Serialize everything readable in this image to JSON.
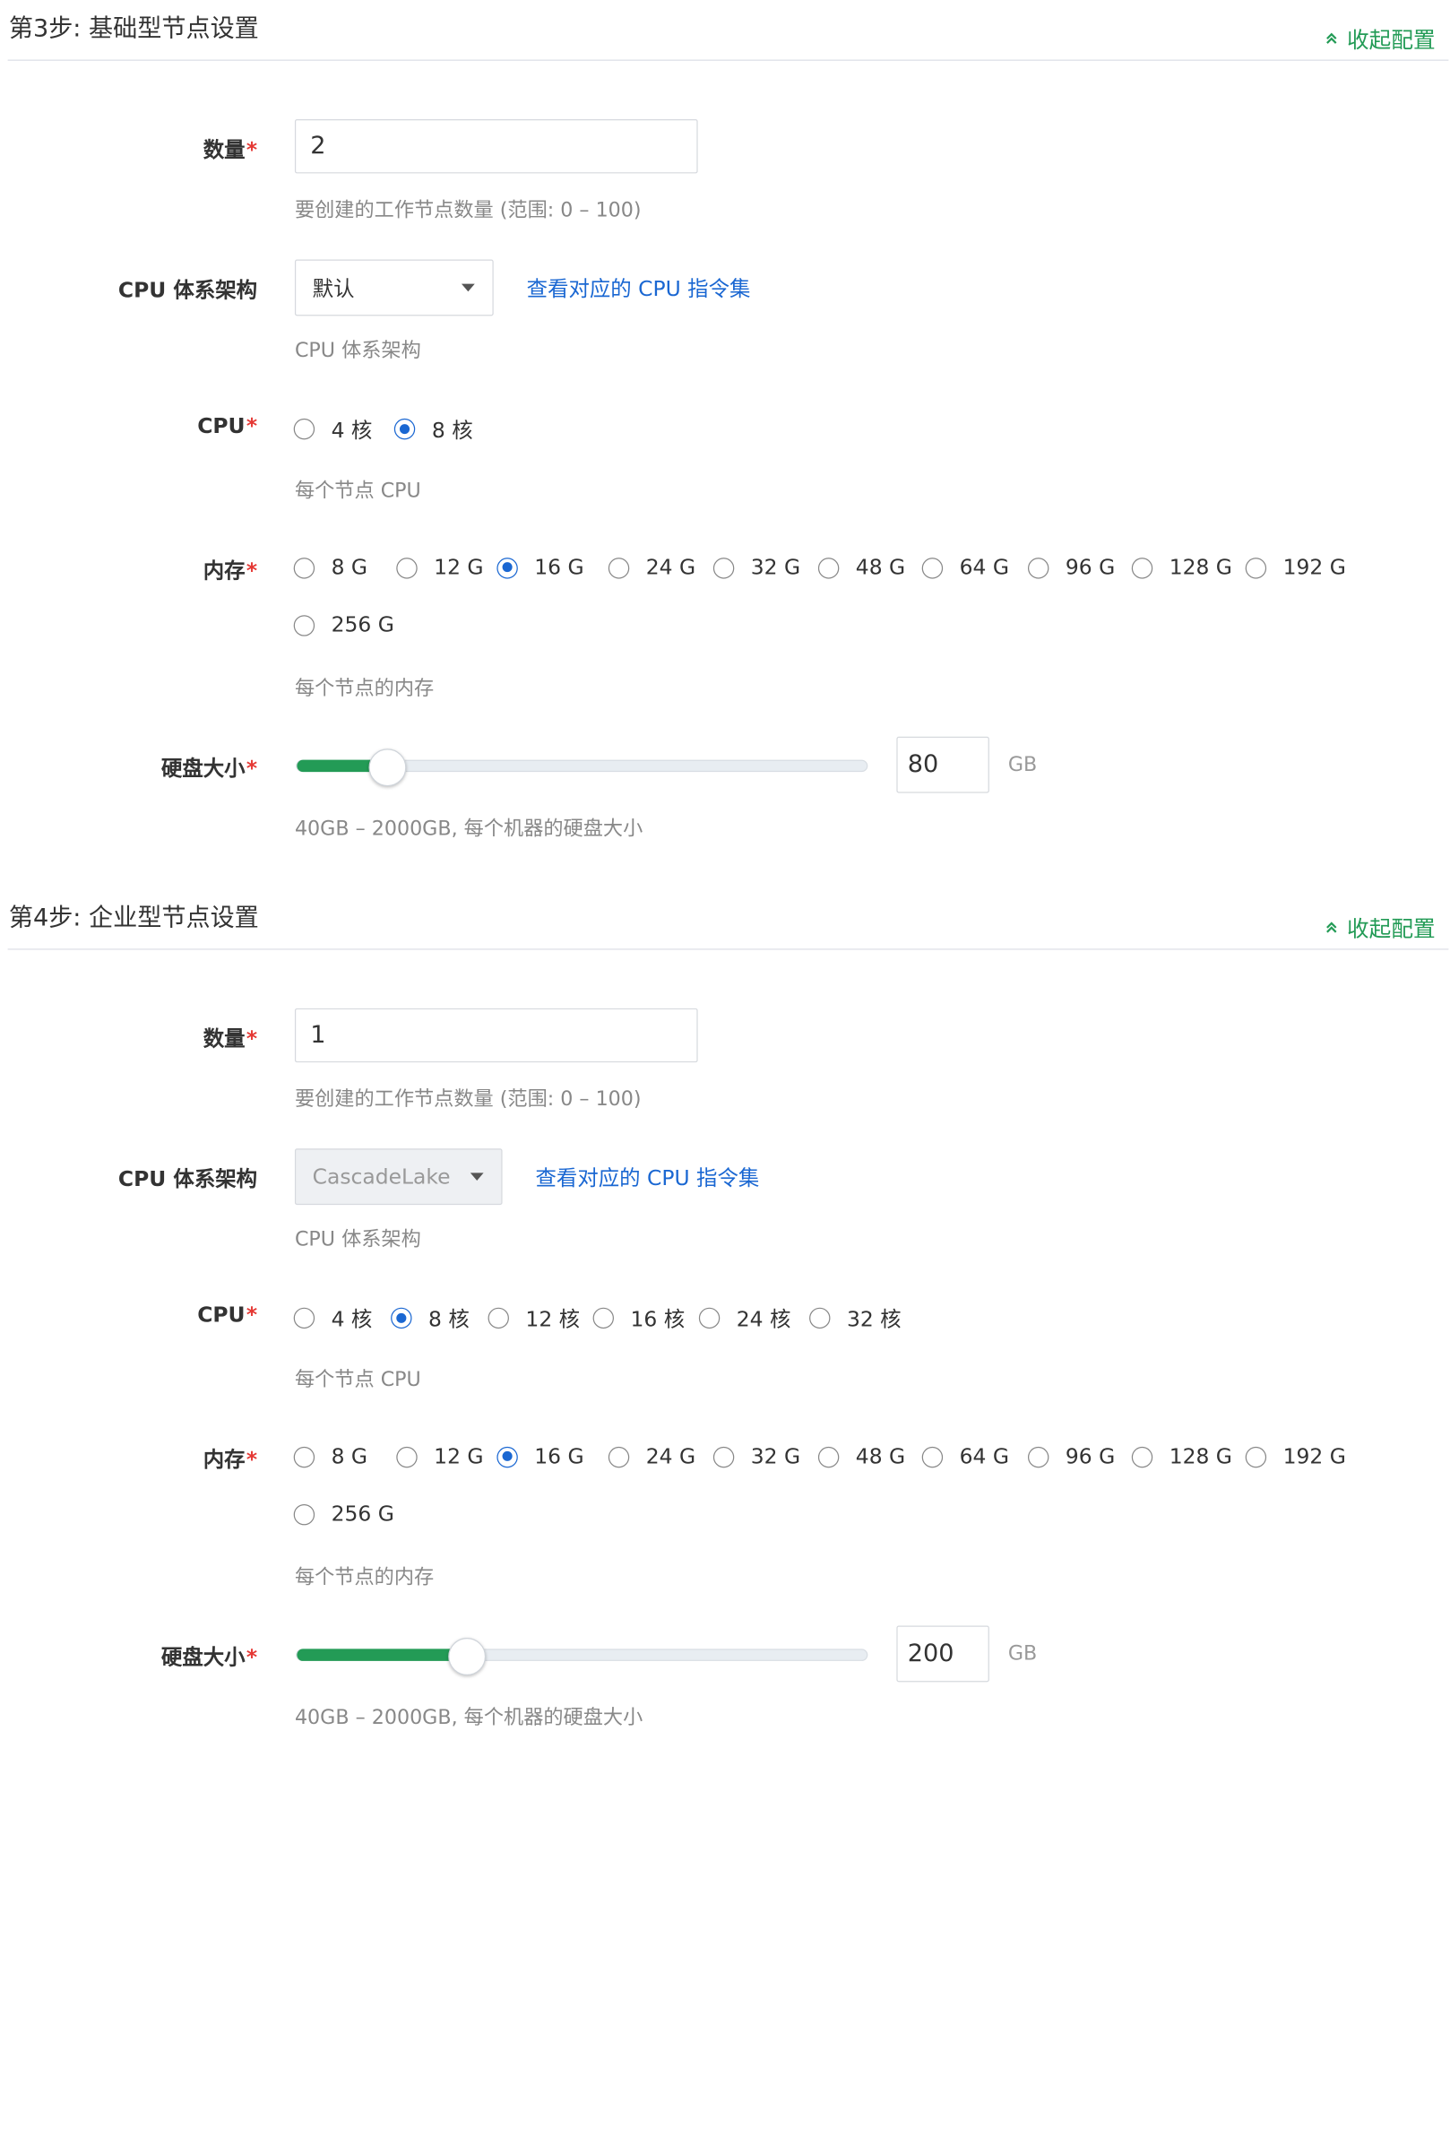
{
  "steps": [
    {
      "title": "第3步: 基础型节点设置",
      "collapse_label": "收起配置",
      "count": {
        "label": "数量",
        "value": "2",
        "help": "要创建的工作节点数量 (范围: 0 – 100)"
      },
      "arch": {
        "label": "CPU 体系架构",
        "value": "默认",
        "disabled": false,
        "link": "查看对应的 CPU 指令集",
        "help": "CPU 体系架构"
      },
      "cpu": {
        "label": "CPU",
        "options": [
          "4 核",
          "8 核"
        ],
        "selected": "8 核",
        "help": "每个节点 CPU"
      },
      "memory": {
        "label": "内存",
        "options": [
          "8 G",
          "12 G",
          "16 G",
          "24 G",
          "32 G",
          "48 G",
          "64 G",
          "96 G",
          "128 G",
          "192 G",
          "256 G"
        ],
        "selected": "16 G",
        "help": "每个节点的内存"
      },
      "disk": {
        "label": "硬盘大小",
        "value": "80",
        "min": 40,
        "max": 2000,
        "unit": "GB",
        "help": "40GB – 2000GB, 每个机器的硬盘大小"
      }
    },
    {
      "title": "第4步: 企业型节点设置",
      "collapse_label": "收起配置",
      "count": {
        "label": "数量",
        "value": "1",
        "help": "要创建的工作节点数量 (范围: 0 – 100)"
      },
      "arch": {
        "label": "CPU 体系架构",
        "value": "CascadeLake",
        "disabled": true,
        "link": "查看对应的 CPU 指令集",
        "help": "CPU 体系架构"
      },
      "cpu": {
        "label": "CPU",
        "options": [
          "4 核",
          "8 核",
          "12 核",
          "16 核",
          "24 核",
          "32 核"
        ],
        "selected": "8 核",
        "help": "每个节点 CPU"
      },
      "memory": {
        "label": "内存",
        "options": [
          "8 G",
          "12 G",
          "16 G",
          "24 G",
          "32 G",
          "48 G",
          "64 G",
          "96 G",
          "128 G",
          "192 G",
          "256 G"
        ],
        "selected": "16 G",
        "help": "每个节点的内存"
      },
      "disk": {
        "label": "硬盘大小",
        "value": "200",
        "min": 40,
        "max": 2000,
        "unit": "GB",
        "help": "40GB – 2000GB, 每个机器的硬盘大小"
      }
    }
  ],
  "required_marker": "*",
  "icons": {
    "collapse": "double-chevron-up-icon",
    "dropdown": "caret-down-icon"
  },
  "colors": {
    "accent_green": "#239b56",
    "link_blue": "#1a67d2",
    "required_red": "#e53935"
  }
}
